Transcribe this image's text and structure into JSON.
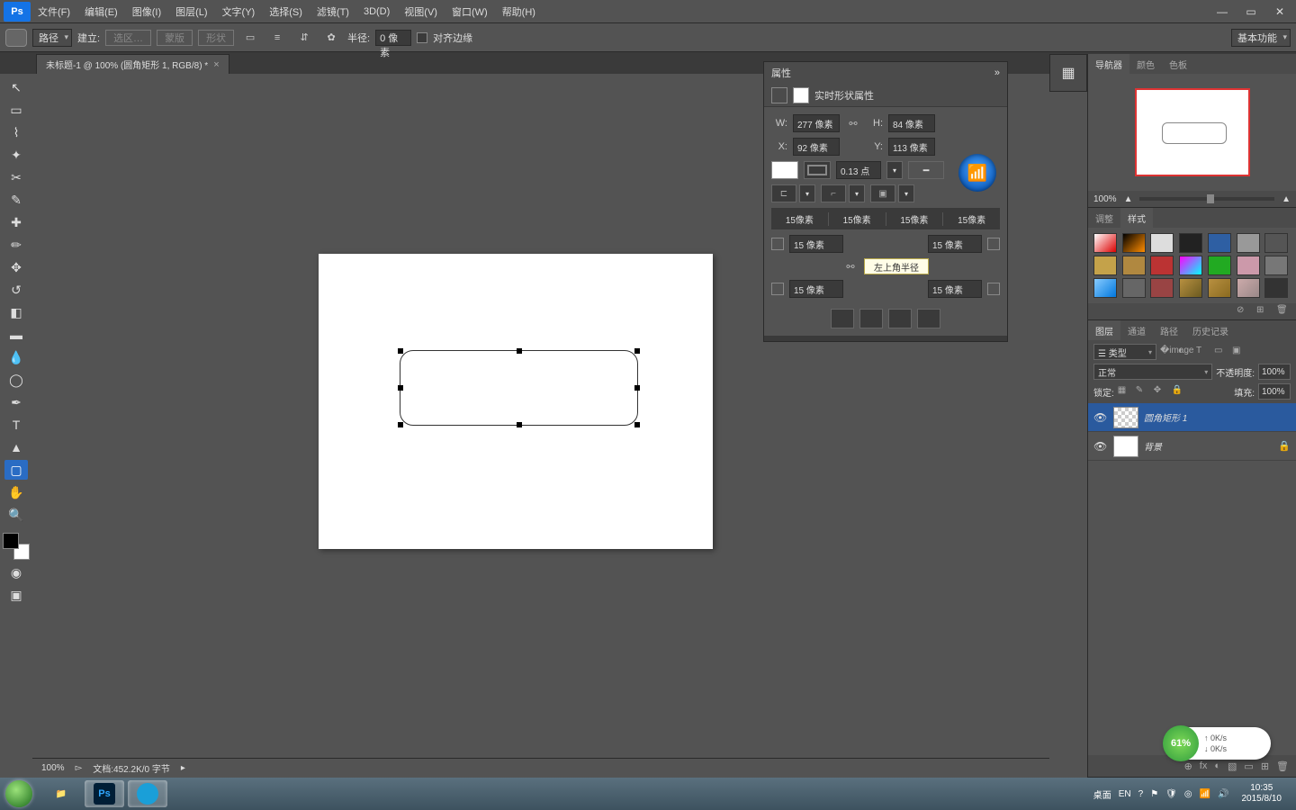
{
  "menubar": {
    "logo": "Ps",
    "items": [
      "文件(F)",
      "编辑(E)",
      "图像(I)",
      "图层(L)",
      "文字(Y)",
      "选择(S)",
      "滤镜(T)",
      "3D(D)",
      "视图(V)",
      "窗口(W)",
      "帮助(H)"
    ]
  },
  "optbar": {
    "mode": "路径",
    "build_label": "建立:",
    "buttons": [
      "选区…",
      "蒙版",
      "形状"
    ],
    "radius_label": "半径:",
    "radius_value": "0 像素",
    "align_label": "对齐边缘",
    "workspace": "基本功能"
  },
  "tab": {
    "title": "未标题-1 @ 100% (圆角矩形 1, RGB/8) *"
  },
  "statusbar": {
    "zoom": "100%",
    "doc": "文档:452.2K/0 字节"
  },
  "properties": {
    "title": "属性",
    "subtitle": "实时形状属性",
    "w_label": "W:",
    "w": "277 像素",
    "h_label": "H:",
    "h": "84 像素",
    "x_label": "X:",
    "x": "92 像素",
    "y_label": "Y:",
    "y": "113 像素",
    "stroke_width": "0.13 点",
    "radii_combined": [
      "15像素",
      "15像素",
      "15像素",
      "15像素"
    ],
    "corners": {
      "tl": "15 像素",
      "tr": "15 像素",
      "bl": "15 像素",
      "br": "15 像素"
    },
    "tooltip": "左上角半径"
  },
  "navigator": {
    "tabs": [
      "导航器",
      "颜色",
      "色板"
    ],
    "zoom": "100%"
  },
  "adjust": {
    "tabs": [
      "调整",
      "样式"
    ],
    "colors": [
      "#fff,#d00",
      "#000,#ff8c00",
      "#ddd,#ddd",
      "#222,#222",
      "#2e5fa3,#2e5fa3",
      "#999,#999",
      "#555,#555",
      "#c4a24a,#c4a24a",
      "#b08840,#b08840",
      "#b33,#b33",
      "#f0f,#0ff",
      "#2a2,#2a2",
      "#c9a,#c9a",
      "#777,#777",
      "#8cf,#07d",
      "#666,#666",
      "#944,#944",
      "#b89040,#6b5a20",
      "#b89040,#8a6a20",
      "#caa,#988",
      "#333,#333"
    ]
  },
  "layers": {
    "tabs": [
      "图层",
      "通道",
      "路径",
      "历史记录"
    ],
    "kind": "☰ 类型",
    "mode": "正常",
    "opacity_label": "不透明度:",
    "opacity": "100%",
    "lock_label": "锁定:",
    "fill_label": "填充:",
    "fill": "100%",
    "items": [
      {
        "name": "圆角矩形 1",
        "active": true
      },
      {
        "name": "背景",
        "locked": true
      }
    ],
    "foot_icons": [
      "⊕",
      "fx",
      "◐",
      "▧",
      "▭",
      "⊞",
      "🗑"
    ]
  },
  "net": {
    "pct": "61%",
    "up": "0K/s",
    "down": "0K/s"
  },
  "taskbar": {
    "desktop": "桌面",
    "ime": "EN",
    "time": "10:35",
    "date": "2015/8/10"
  }
}
